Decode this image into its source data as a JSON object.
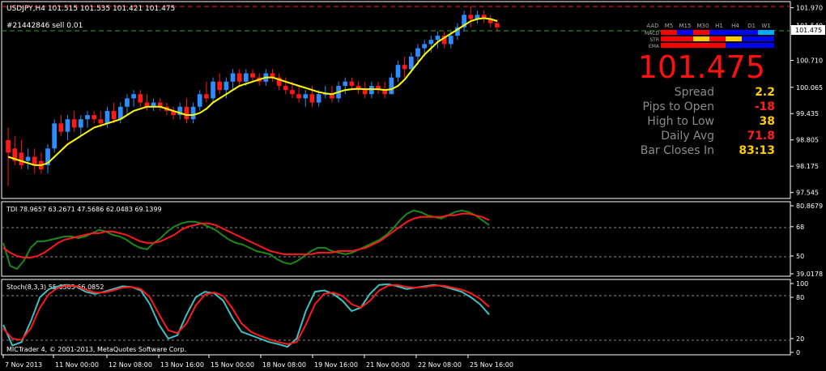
{
  "main": {
    "title": "USDJPY,H4  101.515 101.535 101.421 101.475",
    "order": "#21442846 sell 0.01",
    "price_label": "101.475",
    "y_ticks": [
      "101.970",
      "101.540",
      "100.710",
      "100.065",
      "99.435",
      "98.805",
      "98.175",
      "97.545"
    ]
  },
  "panel": {
    "tf_labels": [
      "AAD",
      "M5",
      "M15",
      "M30",
      "H1",
      "H4",
      "D1",
      "W1"
    ],
    "row_labels": [
      "MACD",
      "STR",
      "EMA"
    ],
    "row_colors": [
      [
        "#ff0000",
        "#0000ff",
        "#ff0000",
        "#0000ff",
        "#0000ff",
        "#0000ff",
        "#00aaff"
      ],
      [
        "#ff0000",
        "#ff0000",
        "#ffcc00",
        "#ff0000",
        "#ffcc00",
        "#0000ff",
        "#0000ff"
      ],
      [
        "#ff0000",
        "#ff0000",
        "#ff0000",
        "#ff0000",
        "#0000ff",
        "#0000ff",
        "#0000ff"
      ]
    ],
    "big_price": "101.475",
    "stats": [
      {
        "label": "Spread",
        "value": "2.2",
        "color": "#ffcc00"
      },
      {
        "label": "Pips to Open",
        "value": "-18",
        "color": "#ff2020"
      },
      {
        "label": "High to Low",
        "value": "38",
        "color": "#ffcc00"
      },
      {
        "label": "Daily Avg",
        "value": "71.8",
        "color": "#ff2020"
      },
      {
        "label": "Bar Closes In",
        "value": "83:13",
        "color": "#ffcc00"
      }
    ]
  },
  "tdi": {
    "title": "TDI 78.9657 63.2671 47.5686 62.0483 69.1399",
    "y_ticks": [
      "80.8679",
      "68",
      "50",
      "39.0178"
    ]
  },
  "stoch": {
    "title": "Stoch(8,3,3) 55.6565 66.0852",
    "y_ticks": [
      "100",
      "80",
      "20",
      "0"
    ]
  },
  "copyright": "MICTrader 4, © 2001-2013, MetaQuotes Software Corp.",
  "x_labels": [
    "7 Nov 2013",
    "11 Nov 00:00",
    "12 Nov 08:00",
    "13 Nov 16:00",
    "15 Nov 00:00",
    "18 Nov 08:00",
    "19 Nov 16:00",
    "21 Nov 00:00",
    "22 Nov 08:00",
    "25 Nov 16:00"
  ],
  "chart_data": [
    {
      "type": "candlestick",
      "title": "USDJPY,H4",
      "ylim": [
        97.5,
        102.0
      ],
      "candles": [
        {
          "o": 98.8,
          "h": 99.1,
          "l": 97.7,
          "c": 98.5
        },
        {
          "o": 98.6,
          "h": 98.9,
          "l": 98.2,
          "c": 98.3
        },
        {
          "o": 98.5,
          "h": 98.8,
          "l": 98.1,
          "c": 98.2
        },
        {
          "o": 98.3,
          "h": 98.6,
          "l": 98.1,
          "c": 98.4
        },
        {
          "o": 98.4,
          "h": 98.6,
          "l": 98.0,
          "c": 98.2
        },
        {
          "o": 98.3,
          "h": 98.5,
          "l": 98.0,
          "c": 98.1
        },
        {
          "o": 98.2,
          "h": 98.7,
          "l": 98.0,
          "c": 98.6
        },
        {
          "o": 98.6,
          "h": 99.3,
          "l": 98.5,
          "c": 99.2
        },
        {
          "o": 99.2,
          "h": 99.4,
          "l": 98.9,
          "c": 99.0
        },
        {
          "o": 99.0,
          "h": 99.4,
          "l": 98.8,
          "c": 99.3
        },
        {
          "o": 99.3,
          "h": 99.5,
          "l": 99.0,
          "c": 99.1
        },
        {
          "o": 99.1,
          "h": 99.4,
          "l": 98.9,
          "c": 99.3
        },
        {
          "o": 99.3,
          "h": 99.5,
          "l": 99.1,
          "c": 99.4
        },
        {
          "o": 99.4,
          "h": 99.5,
          "l": 99.2,
          "c": 99.3
        },
        {
          "o": 99.3,
          "h": 99.5,
          "l": 99.1,
          "c": 99.2
        },
        {
          "o": 99.2,
          "h": 99.6,
          "l": 99.1,
          "c": 99.5
        },
        {
          "o": 99.5,
          "h": 99.7,
          "l": 99.2,
          "c": 99.3
        },
        {
          "o": 99.3,
          "h": 99.7,
          "l": 99.2,
          "c": 99.6
        },
        {
          "o": 99.6,
          "h": 99.9,
          "l": 99.4,
          "c": 99.8
        },
        {
          "o": 99.8,
          "h": 100.0,
          "l": 99.6,
          "c": 99.9
        },
        {
          "o": 99.9,
          "h": 100.0,
          "l": 99.6,
          "c": 99.7
        },
        {
          "o": 99.7,
          "h": 99.9,
          "l": 99.5,
          "c": 99.6
        },
        {
          "o": 99.6,
          "h": 99.8,
          "l": 99.5,
          "c": 99.7
        },
        {
          "o": 99.7,
          "h": 99.8,
          "l": 99.5,
          "c": 99.6
        },
        {
          "o": 99.6,
          "h": 99.7,
          "l": 99.4,
          "c": 99.5
        },
        {
          "o": 99.5,
          "h": 99.6,
          "l": 99.3,
          "c": 99.4
        },
        {
          "o": 99.4,
          "h": 99.7,
          "l": 99.3,
          "c": 99.6
        },
        {
          "o": 99.6,
          "h": 99.8,
          "l": 99.2,
          "c": 99.3
        },
        {
          "o": 99.3,
          "h": 99.7,
          "l": 99.2,
          "c": 99.6
        },
        {
          "o": 99.6,
          "h": 100.0,
          "l": 99.5,
          "c": 99.9
        },
        {
          "o": 99.9,
          "h": 100.2,
          "l": 99.7,
          "c": 99.8
        },
        {
          "o": 99.8,
          "h": 100.3,
          "l": 99.7,
          "c": 100.2
        },
        {
          "o": 100.2,
          "h": 100.4,
          "l": 99.9,
          "c": 100.0
        },
        {
          "o": 100.0,
          "h": 100.3,
          "l": 99.8,
          "c": 100.2
        },
        {
          "o": 100.2,
          "h": 100.5,
          "l": 100.0,
          "c": 100.4
        },
        {
          "o": 100.4,
          "h": 100.5,
          "l": 100.1,
          "c": 100.2
        },
        {
          "o": 100.2,
          "h": 100.5,
          "l": 100.1,
          "c": 100.4
        },
        {
          "o": 100.4,
          "h": 100.5,
          "l": 100.2,
          "c": 100.3
        },
        {
          "o": 100.3,
          "h": 100.4,
          "l": 100.1,
          "c": 100.2
        },
        {
          "o": 100.2,
          "h": 100.5,
          "l": 100.1,
          "c": 100.4
        },
        {
          "o": 100.4,
          "h": 100.5,
          "l": 100.2,
          "c": 100.3
        },
        {
          "o": 100.3,
          "h": 100.4,
          "l": 100.0,
          "c": 100.1
        },
        {
          "o": 100.1,
          "h": 100.3,
          "l": 99.9,
          "c": 100.0
        },
        {
          "o": 100.0,
          "h": 100.2,
          "l": 99.8,
          "c": 99.9
        },
        {
          "o": 99.9,
          "h": 100.1,
          "l": 99.7,
          "c": 99.8
        },
        {
          "o": 99.8,
          "h": 100.0,
          "l": 99.6,
          "c": 99.9
        },
        {
          "o": 99.9,
          "h": 100.1,
          "l": 99.6,
          "c": 99.7
        },
        {
          "o": 99.7,
          "h": 100.0,
          "l": 99.6,
          "c": 99.9
        },
        {
          "o": 99.9,
          "h": 100.1,
          "l": 99.8,
          "c": 99.9
        },
        {
          "o": 99.9,
          "h": 100.1,
          "l": 99.7,
          "c": 99.8
        },
        {
          "o": 99.8,
          "h": 100.2,
          "l": 99.7,
          "c": 100.1
        },
        {
          "o": 100.1,
          "h": 100.3,
          "l": 99.9,
          "c": 100.2
        },
        {
          "o": 100.2,
          "h": 100.3,
          "l": 100.0,
          "c": 100.1
        },
        {
          "o": 100.1,
          "h": 100.2,
          "l": 99.9,
          "c": 100.0
        },
        {
          "o": 100.0,
          "h": 100.2,
          "l": 99.8,
          "c": 99.9
        },
        {
          "o": 99.9,
          "h": 100.2,
          "l": 99.8,
          "c": 100.1
        },
        {
          "o": 100.1,
          "h": 100.2,
          "l": 99.9,
          "c": 100.0
        },
        {
          "o": 100.0,
          "h": 100.2,
          "l": 99.8,
          "c": 99.9
        },
        {
          "o": 99.9,
          "h": 100.4,
          "l": 99.9,
          "c": 100.3
        },
        {
          "o": 100.3,
          "h": 100.7,
          "l": 100.2,
          "c": 100.6
        },
        {
          "o": 100.6,
          "h": 100.8,
          "l": 100.3,
          "c": 100.5
        },
        {
          "o": 100.5,
          "h": 100.9,
          "l": 100.4,
          "c": 100.8
        },
        {
          "o": 100.8,
          "h": 101.1,
          "l": 100.6,
          "c": 101.0
        },
        {
          "o": 101.0,
          "h": 101.2,
          "l": 100.8,
          "c": 101.1
        },
        {
          "o": 101.1,
          "h": 101.3,
          "l": 100.9,
          "c": 101.2
        },
        {
          "o": 101.2,
          "h": 101.4,
          "l": 101.0,
          "c": 101.3
        },
        {
          "o": 101.3,
          "h": 101.4,
          "l": 101.0,
          "c": 101.1
        },
        {
          "o": 101.1,
          "h": 101.4,
          "l": 101.0,
          "c": 101.3
        },
        {
          "o": 101.3,
          "h": 101.6,
          "l": 101.2,
          "c": 101.5
        },
        {
          "o": 101.5,
          "h": 101.9,
          "l": 101.4,
          "c": 101.8
        },
        {
          "o": 101.8,
          "h": 102.0,
          "l": 101.5,
          "c": 101.7
        },
        {
          "o": 101.7,
          "h": 101.9,
          "l": 101.6,
          "c": 101.8
        },
        {
          "o": 101.8,
          "h": 101.9,
          "l": 101.6,
          "c": 101.7
        },
        {
          "o": 101.7,
          "h": 101.8,
          "l": 101.5,
          "c": 101.6
        },
        {
          "o": 101.6,
          "h": 101.7,
          "l": 101.4,
          "c": 101.5
        }
      ],
      "ma": [
        98.4,
        98.35,
        98.3,
        98.25,
        98.2,
        98.2,
        98.25,
        98.4,
        98.55,
        98.7,
        98.8,
        98.9,
        99.0,
        99.1,
        99.15,
        99.2,
        99.25,
        99.3,
        99.4,
        99.5,
        99.55,
        99.6,
        99.6,
        99.6,
        99.55,
        99.5,
        99.45,
        99.4,
        99.4,
        99.45,
        99.55,
        99.7,
        99.8,
        99.9,
        100.0,
        100.1,
        100.15,
        100.2,
        100.25,
        100.3,
        100.3,
        100.25,
        100.2,
        100.15,
        100.1,
        100.05,
        100.0,
        99.95,
        99.92,
        99.9,
        99.95,
        100.0,
        100.02,
        100.03,
        100.02,
        100.02,
        100.02,
        100.0,
        100.02,
        100.1,
        100.25,
        100.45,
        100.65,
        100.85,
        101.0,
        101.15,
        101.25,
        101.35,
        101.45,
        101.55,
        101.65,
        101.7,
        101.72,
        101.7,
        101.65
      ]
    },
    {
      "type": "line",
      "title": "TDI",
      "ylim": [
        39.0178,
        80.8679
      ],
      "series": [
        {
          "name": "green",
          "values": [
            58,
            44,
            42,
            47,
            55,
            59,
            59,
            60,
            61,
            62,
            62,
            61,
            62,
            64,
            66,
            65,
            63,
            62,
            60,
            57,
            55,
            54,
            58,
            61,
            65,
            68,
            70,
            71,
            71,
            70,
            68,
            66,
            63,
            60,
            58,
            57,
            55,
            53,
            52,
            51,
            48,
            46,
            45,
            47,
            50,
            53,
            55,
            55,
            53,
            52,
            51,
            52,
            54,
            56,
            58,
            60,
            63,
            67,
            72,
            76,
            78,
            77,
            75,
            74,
            73,
            75,
            77,
            78,
            77,
            75,
            72,
            69
          ]
        },
        {
          "name": "red",
          "values": [
            55,
            52,
            50,
            49,
            49,
            50,
            52,
            55,
            58,
            60,
            61,
            62,
            63,
            64,
            64,
            65,
            65,
            64,
            63,
            61,
            59,
            58,
            58,
            59,
            61,
            63,
            66,
            68,
            69,
            70,
            70,
            69,
            67,
            65,
            63,
            61,
            59,
            57,
            55,
            53,
            52,
            51,
            51,
            51,
            51,
            51,
            52,
            52,
            52,
            53,
            53,
            53,
            54,
            55,
            57,
            59,
            62,
            65,
            68,
            71,
            73,
            74,
            74,
            74,
            74,
            75,
            75,
            76,
            76,
            75,
            74,
            72
          ]
        }
      ]
    },
    {
      "type": "line",
      "title": "Stoch(8,3,3)",
      "ylim": [
        0,
        100
      ],
      "series": [
        {
          "name": "main",
          "values": [
            40,
            10,
            15,
            45,
            80,
            92,
            96,
            98,
            95,
            88,
            85,
            88,
            92,
            96,
            95,
            90,
            70,
            40,
            20,
            25,
            55,
            80,
            88,
            86,
            75,
            50,
            30,
            25,
            20,
            15,
            12,
            8,
            20,
            60,
            88,
            90,
            85,
            75,
            60,
            65,
            85,
            98,
            99,
            96,
            92,
            94,
            96,
            98,
            96,
            92,
            88,
            80,
            70,
            55
          ]
        },
        {
          "name": "signal",
          "values": [
            35,
            20,
            18,
            35,
            65,
            85,
            94,
            97,
            96,
            91,
            87,
            87,
            90,
            94,
            95,
            92,
            80,
            55,
            32,
            28,
            42,
            68,
            84,
            87,
            82,
            64,
            42,
            30,
            24,
            19,
            15,
            12,
            15,
            40,
            70,
            85,
            87,
            82,
            70,
            65,
            75,
            90,
            97,
            98,
            95,
            94,
            95,
            97,
            97,
            94,
            91,
            86,
            78,
            66
          ]
        }
      ]
    }
  ]
}
